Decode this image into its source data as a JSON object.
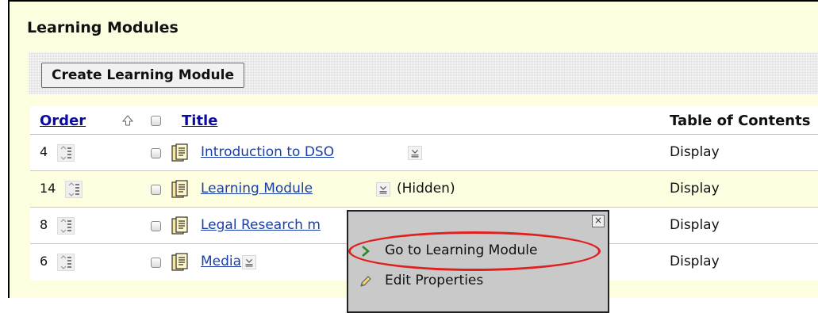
{
  "section": {
    "title": "Learning Modules"
  },
  "toolbar": {
    "create_label": "Create Learning Module"
  },
  "table": {
    "headers": {
      "order": "Order",
      "title": "Title",
      "toc": "Table of Contents"
    },
    "rows": [
      {
        "order": "4",
        "title": "Introduction to DSO",
        "hidden": "",
        "toc": "Display"
      },
      {
        "order": "14",
        "title": "Learning Module",
        "hidden": "(Hidden)",
        "toc": "Display"
      },
      {
        "order": "8",
        "title": "Legal Research m",
        "hidden": "",
        "toc": "Display"
      },
      {
        "order": "6",
        "title": "Media",
        "hidden": "",
        "toc": "Display"
      }
    ]
  },
  "context_menu": {
    "close_label": "×",
    "items": [
      {
        "label": "Go to Learning Module",
        "icon": "chevron-right-icon"
      },
      {
        "label": "Edit Properties",
        "icon": "pencil-icon"
      }
    ]
  },
  "colors": {
    "panel_bg": "#fdfde0",
    "link": "#1a3fa8",
    "header_link": "#0b0ba0",
    "highlight": "#e01f1f"
  }
}
